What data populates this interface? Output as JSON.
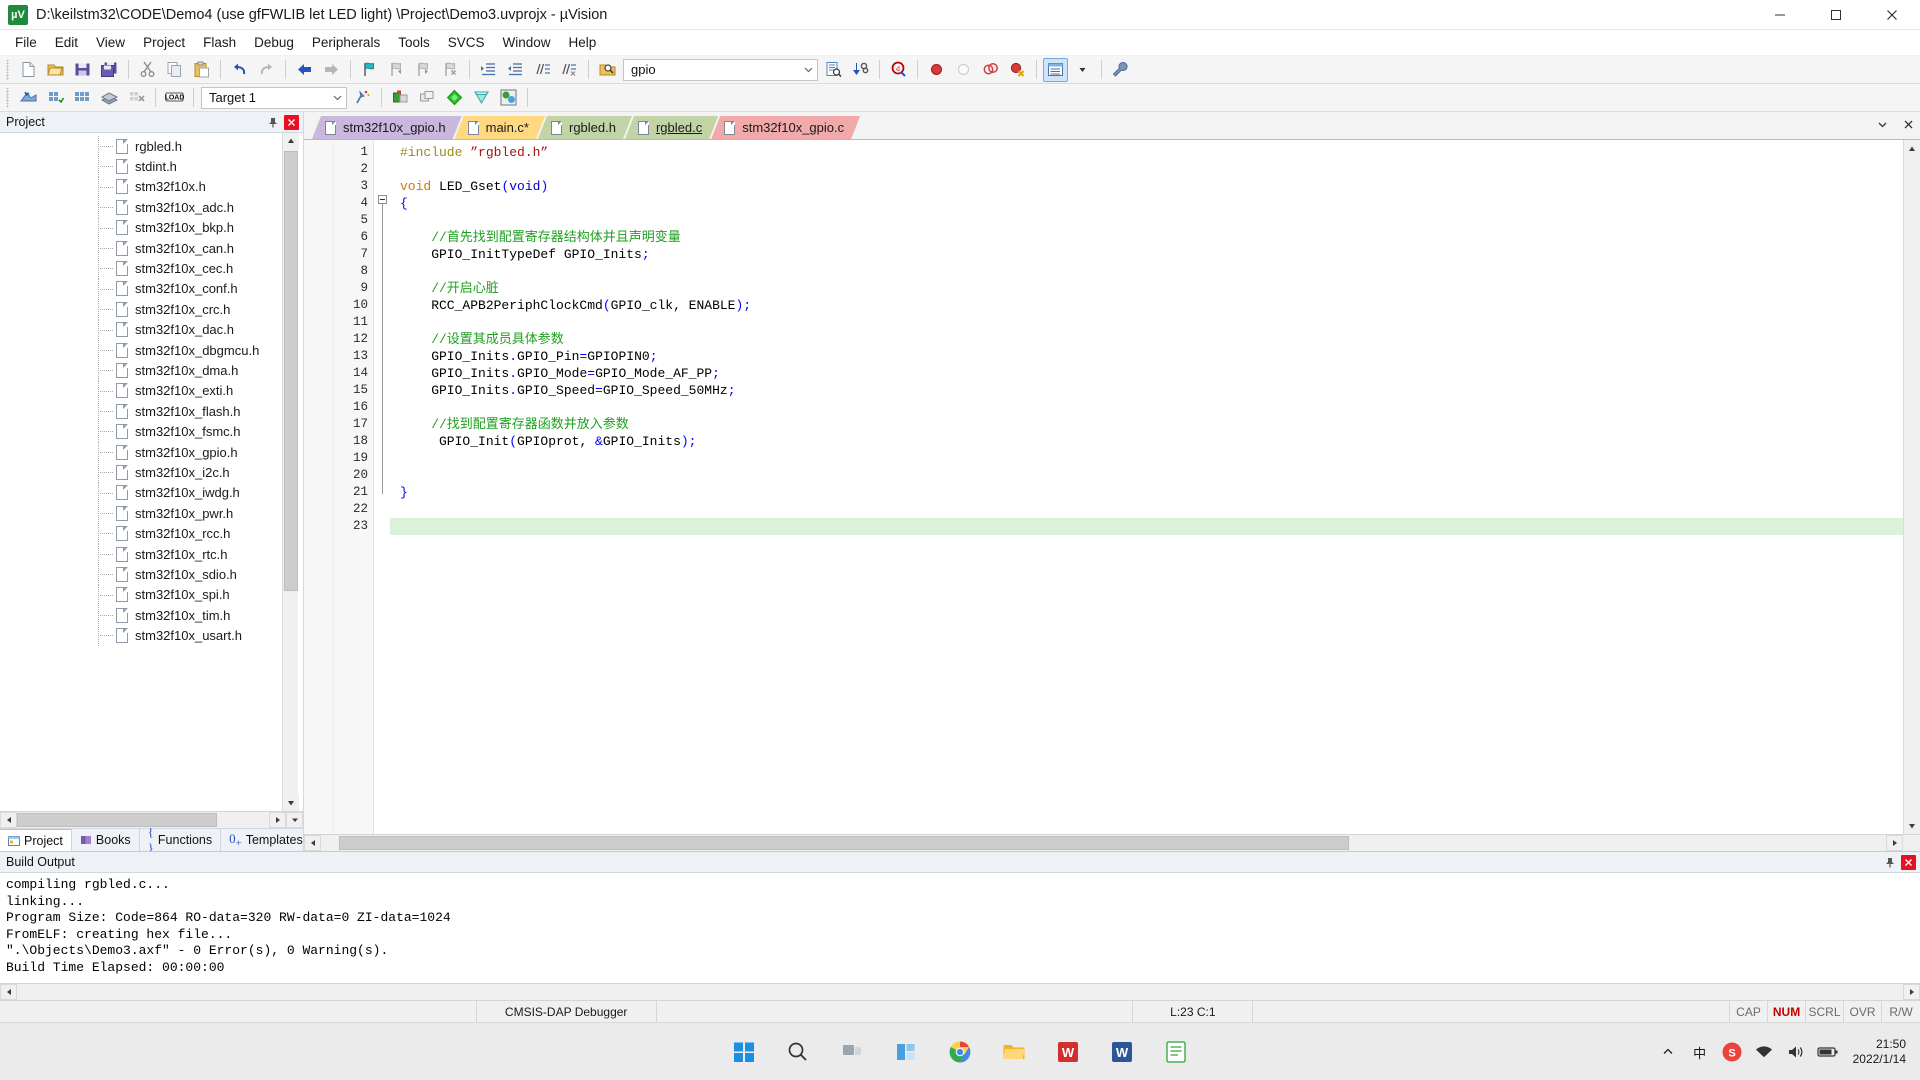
{
  "window": {
    "title": "D:\\keilstm32\\CODE\\Demo4  (use gfFWLIB let LED light)  \\Project\\Demo3.uvprojx - µVision",
    "app_icon_label": "µV",
    "minimize_label": "─",
    "maximize_label": "☐",
    "close_label": "✕"
  },
  "menubar": {
    "items": [
      {
        "label": "File"
      },
      {
        "label": "Edit"
      },
      {
        "label": "View"
      },
      {
        "label": "Project"
      },
      {
        "label": "Flash"
      },
      {
        "label": "Debug"
      },
      {
        "label": "Peripherals"
      },
      {
        "label": "Tools"
      },
      {
        "label": "SVCS"
      },
      {
        "label": "Window"
      },
      {
        "label": "Help"
      }
    ]
  },
  "toolbar_main": {
    "find_combo_value": "gpio",
    "icons": [
      "new-file-icon",
      "open-file-icon",
      "save-icon",
      "save-all-icon",
      "cut-icon",
      "copy-icon",
      "paste-icon",
      "undo-icon",
      "redo-icon",
      "navigate-back-icon",
      "navigate-forward-icon",
      "bookmark-toggle-icon",
      "bookmark-prev-icon",
      "bookmark-next-icon",
      "bookmark-clear-icon",
      "indent-icon",
      "outdent-icon",
      "comment-icon",
      "uncomment-icon",
      "find-in-files-icon",
      "search-dropdown-icon",
      "text-search-icon",
      "browse-symbol-icon",
      "find-icon",
      "insert-breakpoint-icon",
      "remove-breakpoint-icon",
      "disable-breakpoint-icon",
      "kill-breakpoints-icon",
      "window-layout-icon",
      "layout-dropdown-icon",
      "configure-icon"
    ]
  },
  "toolbar_build": {
    "target_combo_value": "Target 1",
    "icons": [
      "translate-icon",
      "build-icon",
      "rebuild-icon",
      "batch-build-icon",
      "stop-build-icon",
      "download-icon",
      "target-options-dropdown-icon",
      "manage-runtime-icon",
      "options-target-icon",
      "multi-project-icon",
      "books-icon",
      "packs-icon",
      "pack-installer-icon"
    ]
  },
  "project_pane": {
    "title": "Project",
    "pin_icon": "pin-icon",
    "close_icon": "close-icon",
    "tree_items": [
      {
        "label": "rgbled.h"
      },
      {
        "label": "stdint.h"
      },
      {
        "label": "stm32f10x.h"
      },
      {
        "label": "stm32f10x_adc.h"
      },
      {
        "label": "stm32f10x_bkp.h"
      },
      {
        "label": "stm32f10x_can.h"
      },
      {
        "label": "stm32f10x_cec.h"
      },
      {
        "label": "stm32f10x_conf.h"
      },
      {
        "label": "stm32f10x_crc.h"
      },
      {
        "label": "stm32f10x_dac.h"
      },
      {
        "label": "stm32f10x_dbgmcu.h"
      },
      {
        "label": "stm32f10x_dma.h"
      },
      {
        "label": "stm32f10x_exti.h"
      },
      {
        "label": "stm32f10x_flash.h"
      },
      {
        "label": "stm32f10x_fsmc.h"
      },
      {
        "label": "stm32f10x_gpio.h"
      },
      {
        "label": "stm32f10x_i2c.h"
      },
      {
        "label": "stm32f10x_iwdg.h"
      },
      {
        "label": "stm32f10x_pwr.h"
      },
      {
        "label": "stm32f10x_rcc.h"
      },
      {
        "label": "stm32f10x_rtc.h"
      },
      {
        "label": "stm32f10x_sdio.h"
      },
      {
        "label": "stm32f10x_spi.h"
      },
      {
        "label": "stm32f10x_tim.h"
      },
      {
        "label": "stm32f10x_usart.h"
      }
    ],
    "bottom_tabs": [
      {
        "label": "Project",
        "icon": "project-icon",
        "active": true
      },
      {
        "label": "Books",
        "icon": "books-icon",
        "active": false
      },
      {
        "label": "Functions",
        "icon": "functions-icon",
        "active": false
      },
      {
        "label": "Templates",
        "icon": "templates-icon",
        "active": false
      }
    ]
  },
  "editor": {
    "tabs": [
      {
        "label": "stm32f10x_gpio.h",
        "color": "#c9b7dd",
        "active": false,
        "modified": false
      },
      {
        "label": "main.c*",
        "color": "#ffd980",
        "active": false,
        "modified": true
      },
      {
        "label": "rgbled.h",
        "color": "#c2d3a6",
        "active": false,
        "modified": false
      },
      {
        "label": "rgbled.c",
        "color": "#c2d3a6",
        "active": true,
        "modified": false
      },
      {
        "label": "stm32f10x_gpio.c",
        "color": "#f2a9a9",
        "active": false,
        "modified": false
      }
    ],
    "tabstrip_scroll_down_icon": "chevron-down-icon",
    "tabstrip_close_icon": "close-icon",
    "highlighted_line": 23,
    "line_count": 23,
    "lines": [
      {
        "n": 1,
        "tokens": [
          {
            "t": "#include ",
            "c": "k-pre"
          },
          {
            "t": "”rgbled.h”",
            "c": "k-str"
          }
        ]
      },
      {
        "n": 2,
        "tokens": []
      },
      {
        "n": 3,
        "tokens": [
          {
            "t": "void",
            "c": "k-kw"
          },
          {
            "t": " LED_Gset",
            "c": "k-plain"
          },
          {
            "t": "(",
            "c": "k-punc"
          },
          {
            "t": "void",
            "c": "k-kw2"
          },
          {
            "t": ")",
            "c": "k-punc"
          }
        ]
      },
      {
        "n": 4,
        "tokens": [
          {
            "t": "{",
            "c": "k-punc"
          }
        ]
      },
      {
        "n": 5,
        "tokens": []
      },
      {
        "n": 6,
        "tokens": [
          {
            "t": "    //首先找到配置寄存器结构体并且声明变量",
            "c": "k-cmt"
          }
        ]
      },
      {
        "n": 7,
        "tokens": [
          {
            "t": "    GPIO_InitTypeDef GPIO_Inits",
            "c": "k-plain"
          },
          {
            "t": ";",
            "c": "k-punc"
          }
        ]
      },
      {
        "n": 8,
        "tokens": []
      },
      {
        "n": 9,
        "tokens": [
          {
            "t": "    //开启心脏",
            "c": "k-cmt"
          }
        ]
      },
      {
        "n": 10,
        "tokens": [
          {
            "t": "    RCC_APB2PeriphClockCmd",
            "c": "k-plain"
          },
          {
            "t": "(",
            "c": "k-punc"
          },
          {
            "t": "GPIO_clk, ENABLE",
            "c": "k-plain"
          },
          {
            "t": ");",
            "c": "k-punc"
          }
        ]
      },
      {
        "n": 11,
        "tokens": []
      },
      {
        "n": 12,
        "tokens": [
          {
            "t": "    //设置其成员具体参数",
            "c": "k-cmt"
          }
        ]
      },
      {
        "n": 13,
        "tokens": [
          {
            "t": "    GPIO_Inits",
            "c": "k-plain"
          },
          {
            "t": ".",
            "c": "k-punc"
          },
          {
            "t": "GPIO_Pin",
            "c": "k-plain"
          },
          {
            "t": "=",
            "c": "k-punc"
          },
          {
            "t": "GPIOPIN0",
            "c": "k-plain"
          },
          {
            "t": ";",
            "c": "k-punc"
          }
        ]
      },
      {
        "n": 14,
        "tokens": [
          {
            "t": "    GPIO_Inits",
            "c": "k-plain"
          },
          {
            "t": ".",
            "c": "k-punc"
          },
          {
            "t": "GPIO_Mode",
            "c": "k-plain"
          },
          {
            "t": "=",
            "c": "k-punc"
          },
          {
            "t": "GPIO_Mode_AF_PP",
            "c": "k-plain"
          },
          {
            "t": ";",
            "c": "k-punc"
          }
        ]
      },
      {
        "n": 15,
        "tokens": [
          {
            "t": "    GPIO_Inits",
            "c": "k-plain"
          },
          {
            "t": ".",
            "c": "k-punc"
          },
          {
            "t": "GPIO_Speed",
            "c": "k-plain"
          },
          {
            "t": "=",
            "c": "k-punc"
          },
          {
            "t": "GPIO_Speed_50MHz",
            "c": "k-plain"
          },
          {
            "t": ";",
            "c": "k-punc"
          }
        ]
      },
      {
        "n": 16,
        "tokens": []
      },
      {
        "n": 17,
        "tokens": [
          {
            "t": "    //找到配置寄存器函数并放入参数",
            "c": "k-cmt"
          }
        ]
      },
      {
        "n": 18,
        "tokens": [
          {
            "t": "     GPIO_Init",
            "c": "k-plain"
          },
          {
            "t": "(",
            "c": "k-punc"
          },
          {
            "t": "GPIOprot, ",
            "c": "k-plain"
          },
          {
            "t": "&",
            "c": "k-punc"
          },
          {
            "t": "GPIO_Inits",
            "c": "k-plain"
          },
          {
            "t": ");",
            "c": "k-punc"
          }
        ]
      },
      {
        "n": 19,
        "tokens": []
      },
      {
        "n": 20,
        "tokens": []
      },
      {
        "n": 21,
        "tokens": [
          {
            "t": "}",
            "c": "k-punc"
          }
        ]
      },
      {
        "n": 22,
        "tokens": []
      },
      {
        "n": 23,
        "tokens": []
      }
    ]
  },
  "build_output": {
    "title": "Build Output",
    "pin_icon": "pin-icon",
    "close_icon": "close-icon",
    "lines": [
      "compiling rgbled.c...",
      "linking...",
      "Program Size: Code=864 RO-data=320 RW-data=0 ZI-data=1024",
      "FromELF: creating hex file...",
      "\".\\Objects\\Demo3.axf\" - 0 Error(s), 0 Warning(s).",
      "Build Time Elapsed:  00:00:00"
    ]
  },
  "statusbar": {
    "debugger": "CMSIS-DAP Debugger",
    "cursor": "L:23 C:1",
    "indicators": [
      {
        "label": "CAP",
        "active": false
      },
      {
        "label": "NUM",
        "active": true
      },
      {
        "label": "SCRL",
        "active": false
      },
      {
        "label": "OVR",
        "active": false
      },
      {
        "label": "R/W",
        "active": false
      }
    ]
  },
  "taskbar": {
    "buttons": [
      {
        "name": "start-button",
        "icon": "windows-logo-icon"
      },
      {
        "name": "search-button",
        "icon": "search-icon"
      },
      {
        "name": "task-view-button",
        "icon": "task-view-icon"
      },
      {
        "name": "widgets-button",
        "icon": "widgets-icon"
      },
      {
        "name": "chrome-button",
        "icon": "chrome-icon"
      },
      {
        "name": "file-explorer-button",
        "icon": "folder-icon"
      },
      {
        "name": "wps-button",
        "icon": "wps-icon"
      },
      {
        "name": "word-button",
        "icon": "word-icon"
      },
      {
        "name": "notes-button",
        "icon": "notes-icon"
      }
    ],
    "tray": {
      "overflow_icon": "chevron-up-icon",
      "ime_label": "中",
      "sogou_label": "S",
      "network_icon": "wifi-icon",
      "volume_icon": "speaker-icon",
      "battery_icon": "battery-icon",
      "time": "21:50",
      "date": "2022/1/14"
    }
  }
}
